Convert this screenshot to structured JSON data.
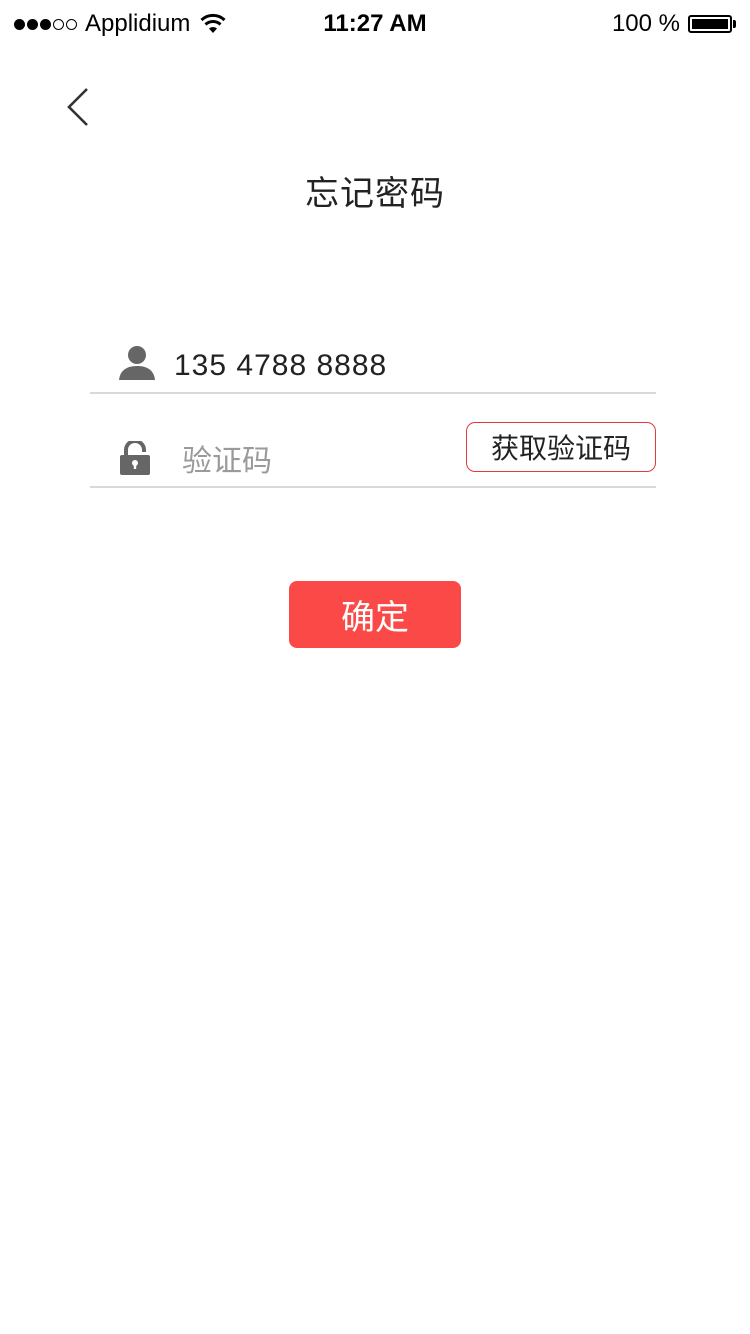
{
  "status_bar": {
    "carrier": "Applidium",
    "time": "11:27 AM",
    "battery": "100 %",
    "signal_strength": 3,
    "signal_total": 5,
    "battery_level": 1.0
  },
  "nav": {
    "back_icon": "chevron-left-icon",
    "title": "忘记密码"
  },
  "form": {
    "phone": {
      "icon": "user-icon",
      "value": "135 4788 8888"
    },
    "code": {
      "icon": "lock-icon",
      "placeholder": "验证码",
      "value": "",
      "get_code_label": "获取验证码"
    },
    "confirm_label": "确定"
  },
  "colors": {
    "accent": "#fb4948",
    "button_border": "#e23a3a",
    "divider": "#d9d9d9",
    "icon": "#666666",
    "placeholder": "#9a9a9a"
  }
}
